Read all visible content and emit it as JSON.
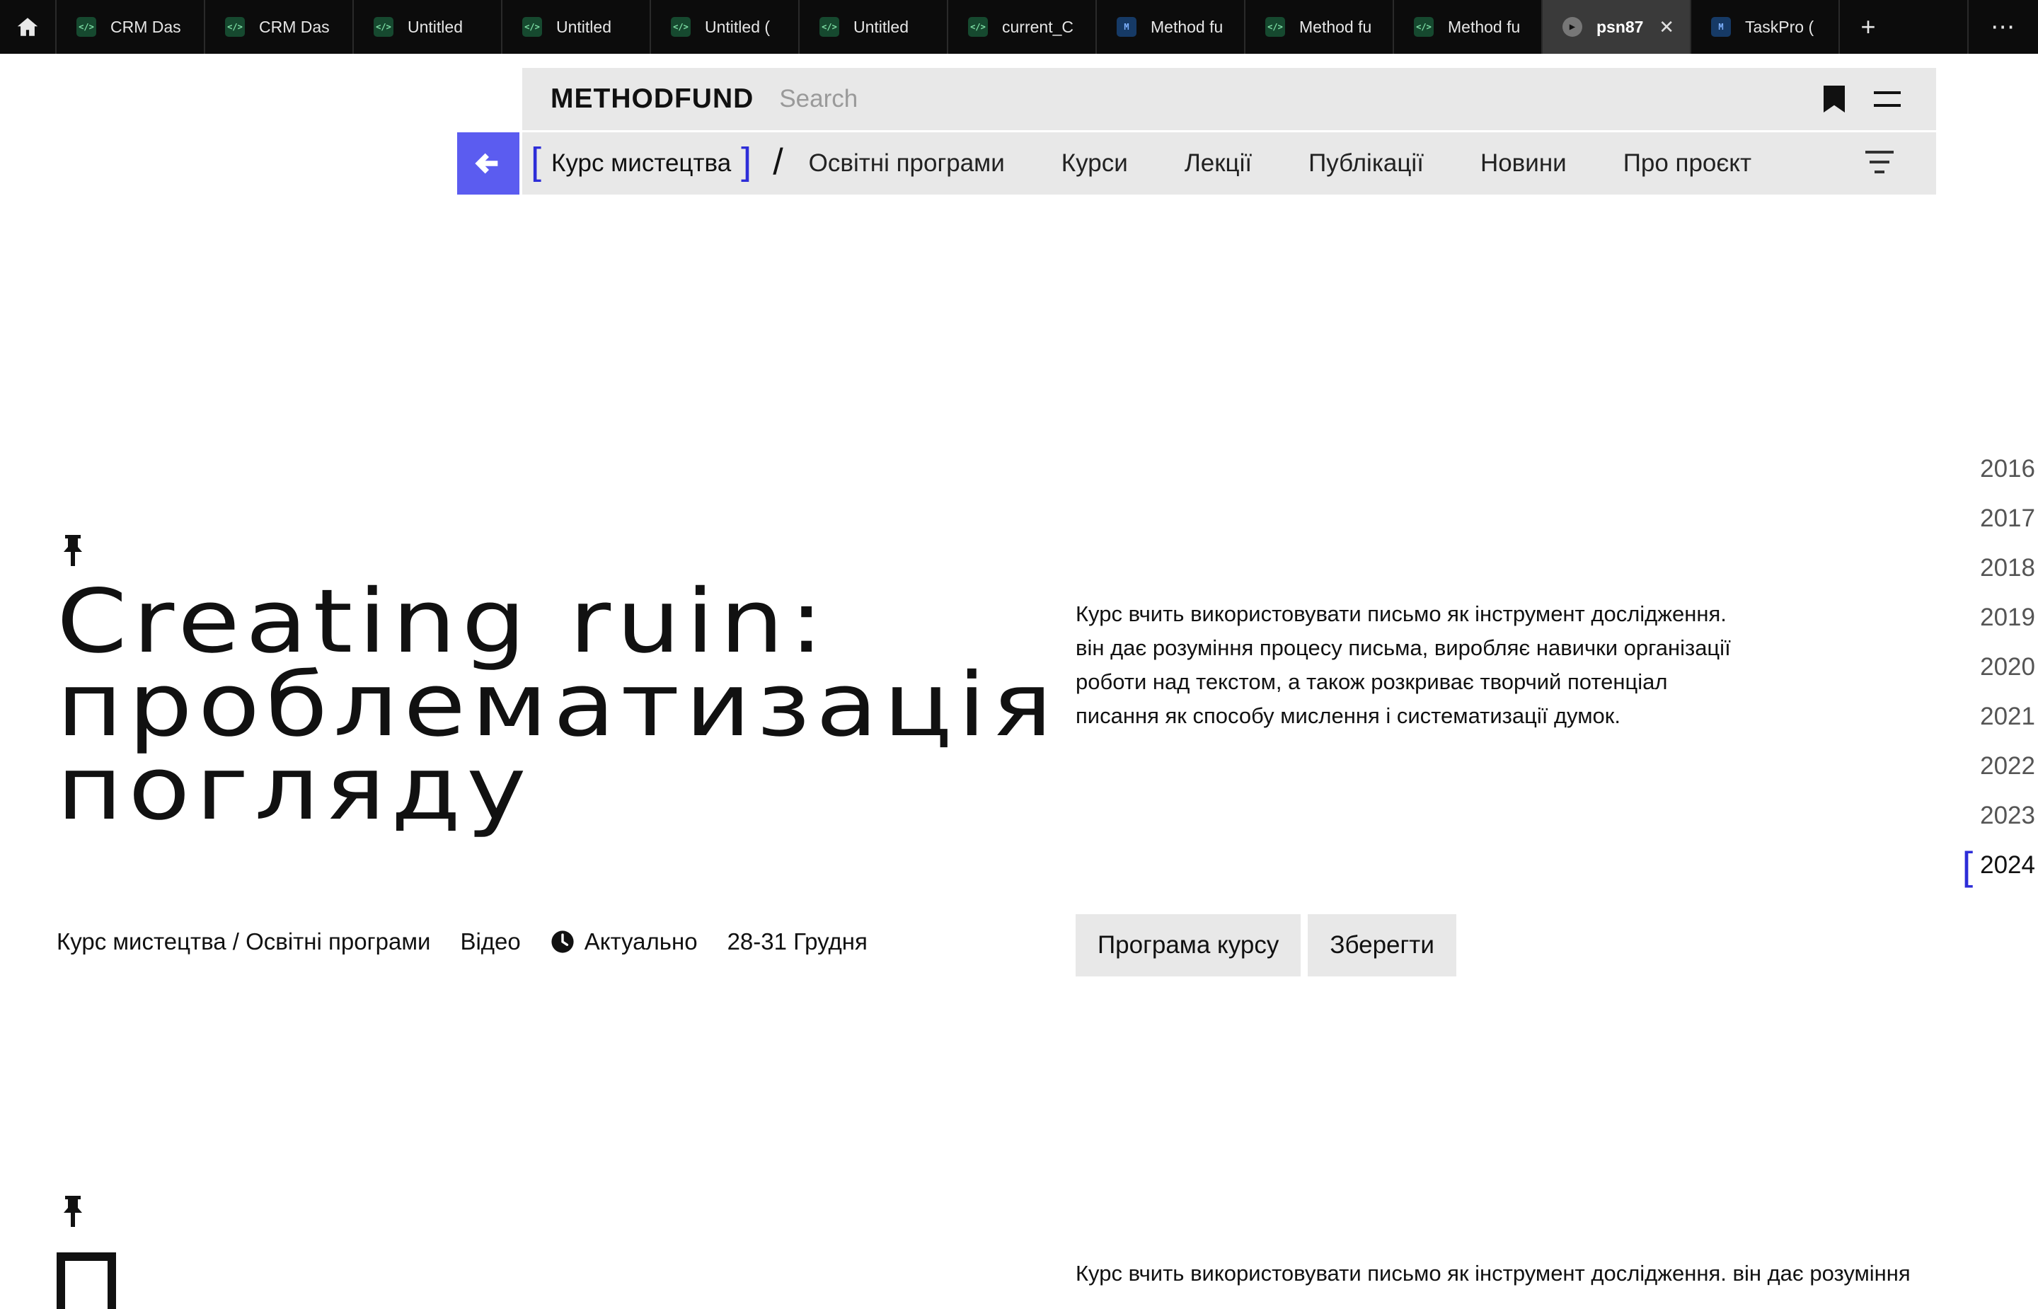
{
  "browser": {
    "tabs": [
      {
        "label": "CRM Das",
        "favicon": "code-icon"
      },
      {
        "label": "CRM Das",
        "favicon": "code-icon"
      },
      {
        "label": "Untitled",
        "favicon": "code-icon"
      },
      {
        "label": "Untitled",
        "favicon": "code-icon"
      },
      {
        "label": "Untitled (",
        "favicon": "code-icon"
      },
      {
        "label": "Untitled",
        "favicon": "code-icon"
      },
      {
        "label": "current_C",
        "favicon": "code-icon"
      },
      {
        "label": "Method fu",
        "favicon": "methodfund-icon"
      },
      {
        "label": "Method fu",
        "favicon": "code-icon"
      },
      {
        "label": "Method fu",
        "favicon": "code-icon"
      },
      {
        "label": "psn87",
        "favicon": "play-icon",
        "active": true,
        "close": "✕"
      },
      {
        "label": "TaskPro (",
        "favicon": "methodfund-icon"
      }
    ],
    "new_tab": "+",
    "menu": "⋯"
  },
  "header": {
    "logo": "METHODFUND",
    "search_placeholder": "Search"
  },
  "nav": {
    "current": "Курс мистецтва",
    "separator": "/",
    "links": [
      "Освітні програми",
      "Курси",
      "Лекції",
      "Публікації",
      "Новини",
      "Про проєкт"
    ]
  },
  "years": {
    "list": [
      "2016",
      "2017",
      "2018",
      "2019",
      "2020",
      "2021",
      "2022",
      "2023",
      "2024"
    ],
    "active": "2024"
  },
  "course": {
    "title_lines": [
      "Creating ruin:",
      "проблематизація",
      "погляду"
    ],
    "description": [
      "Курс вчить використовувати письмо як інструмент дослідження.",
      "він дає розуміння процесу письма, виробляє навички організації",
      "роботи над текстом, а також розкриває творчий потенціал",
      "писання як способу мислення і систематизації думок."
    ],
    "category": "Курс мистецтва / Освітні програми",
    "format": "Відео",
    "status": "Актуально",
    "dates": "28-31 Грудня",
    "program_button": "Програма курсу",
    "save_button": "Зберегти"
  },
  "next_item": {
    "description_preview": "Курс вчить використовувати письмо як інструмент дослідження. він дає розуміння"
  },
  "colors": {
    "accent": "#5b5cf0",
    "bracket": "#2d2dd8",
    "surface": "#e8e8e8",
    "tabbar": "#0c0c0c"
  }
}
